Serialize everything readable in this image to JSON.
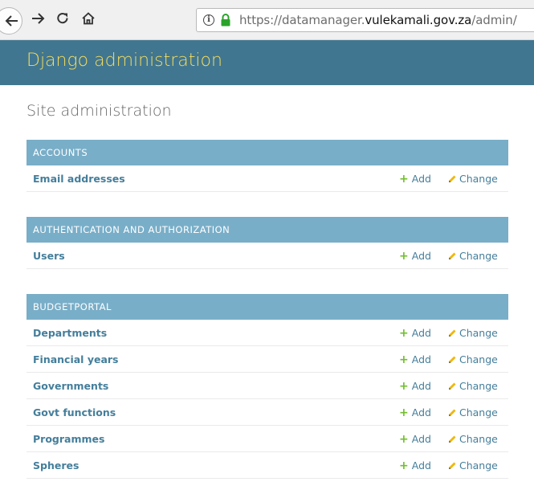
{
  "browser": {
    "url_prefix": "https://datamanager.",
    "url_domain": "vulekamali.gov.za",
    "url_suffix": "/admin/",
    "info_glyph": "i"
  },
  "header": {
    "site_title": "Django administration"
  },
  "page": {
    "title": "Site administration"
  },
  "links": {
    "add": "Add",
    "change": "Change"
  },
  "colors": {
    "header_bg": "#417690",
    "title_yellow": "#f5dd5d",
    "caption_bg": "#79aec8",
    "link": "#447e9b",
    "add_green": "#70bf2b",
    "change_yellow": "#efb80b"
  },
  "icons": {
    "add": "plus-icon",
    "change": "pencil-icon"
  },
  "modules": [
    {
      "caption": "ACCOUNTS",
      "models": [
        "Email addresses"
      ]
    },
    {
      "caption": "AUTHENTICATION AND AUTHORIZATION",
      "models": [
        "Users"
      ]
    },
    {
      "caption": "BUDGETPORTAL",
      "models": [
        "Departments",
        "Financial years",
        "Governments",
        "Govt functions",
        "Programmes",
        "Spheres"
      ]
    }
  ]
}
